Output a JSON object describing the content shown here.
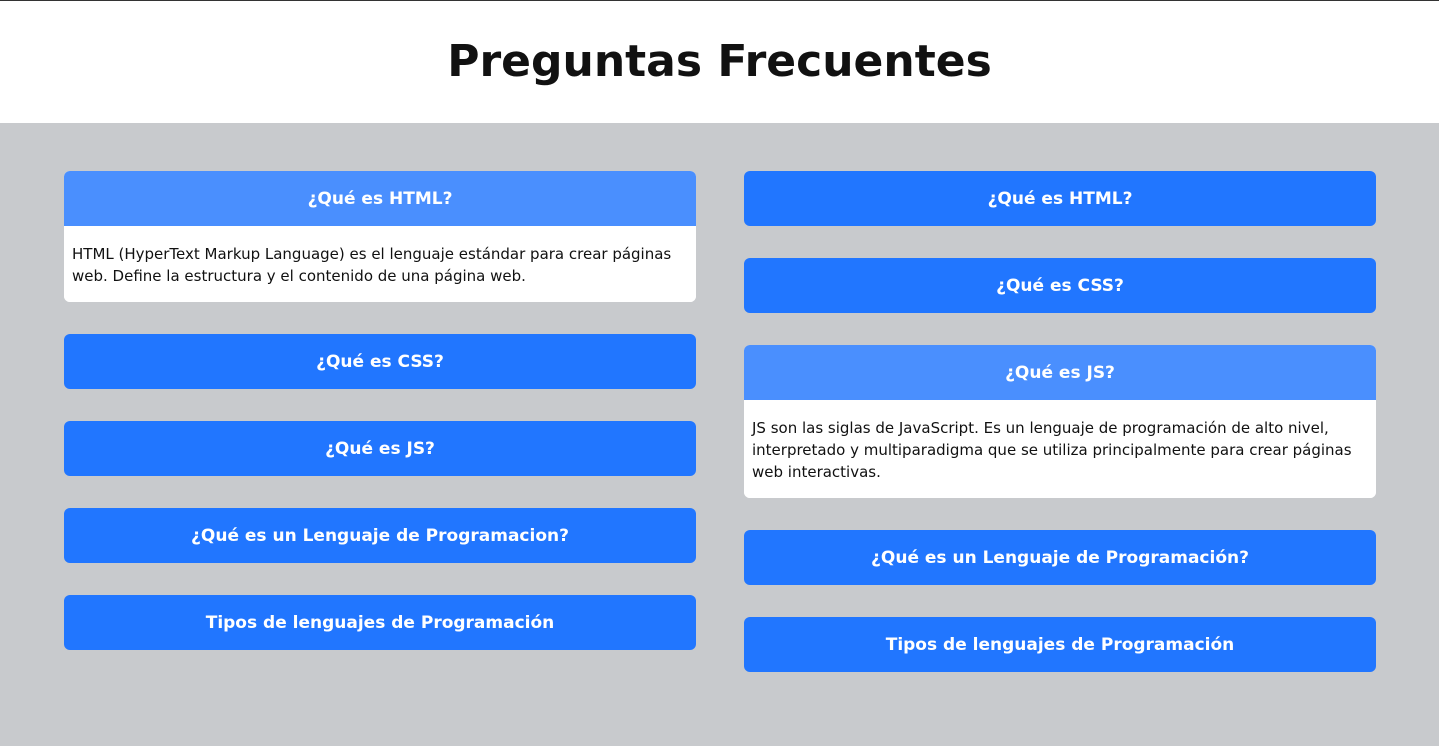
{
  "header": {
    "title": "Preguntas Frecuentes"
  },
  "colors": {
    "header_bg": "#ffffff",
    "page_bg": "#c8cacd",
    "question_bg": "#2176ff",
    "question_open_bg": "#4a8ffe",
    "question_text": "#ffffff",
    "answer_bg": "#ffffff"
  },
  "left_column": {
    "items": [
      {
        "question": "¿Qué es HTML?",
        "answer": "HTML (HyperText Markup Language) es el lenguaje estándar para crear páginas web. Define la estructura y el contenido de una página web.",
        "expanded": true
      },
      {
        "question": "¿Qué es CSS?",
        "expanded": false
      },
      {
        "question": "¿Qué es JS?",
        "expanded": false
      },
      {
        "question": "¿Qué es un Lenguaje de Programacion?",
        "expanded": false
      },
      {
        "question": "Tipos de lenguajes de Programación",
        "expanded": false
      }
    ]
  },
  "right_column": {
    "items": [
      {
        "question": "¿Qué es HTML?",
        "expanded": false
      },
      {
        "question": "¿Qué es CSS?",
        "expanded": false
      },
      {
        "question": "¿Qué es JS?",
        "answer": "JS son las siglas de JavaScript. Es un lenguaje de programación de alto nivel, interpretado y multiparadigma que se utiliza principalmente para crear páginas web interactivas.",
        "expanded": true
      },
      {
        "question": "¿Qué es un Lenguaje de Programación?",
        "expanded": false
      },
      {
        "question": "Tipos de lenguajes de Programación",
        "expanded": false
      }
    ]
  }
}
